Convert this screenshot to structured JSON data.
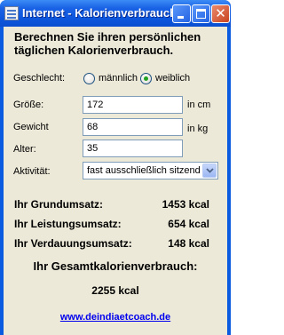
{
  "window": {
    "title": "Internet - Kalorienverbrauch..."
  },
  "heading": "Berechnen Sie ihren persönlichen täglichen Kalorienverbrauch.",
  "gender": {
    "label": "Geschlecht:",
    "options": [
      "männlich",
      "weiblich"
    ],
    "selected": "weiblich"
  },
  "height": {
    "label": "Größe:",
    "value": "172",
    "unit": "in cm"
  },
  "weight": {
    "label": "Gewicht",
    "value": "68",
    "unit": "in kg"
  },
  "age": {
    "label": "Alter:",
    "value": "35"
  },
  "activity": {
    "label": "Aktivität:",
    "selected": "fast ausschließlich sitzend"
  },
  "results": {
    "basal": {
      "label": "Ihr Grundumsatz:",
      "value": "1453 kcal"
    },
    "activity": {
      "label": "Ihr Leistungsumsatz:",
      "value": "654 kcal"
    },
    "digestion": {
      "label": "Ihr Verdauungsumsatz:",
      "value": "148 kcal"
    },
    "total": {
      "label": "Ihr Gesamtkalorienverbrauch:",
      "value": "2255 kcal"
    }
  },
  "link": "www.deindiaetcoach.de",
  "colors": {
    "titlebar": "#0c56dd",
    "client_bg": "#ece9d8",
    "link": "#0000ee",
    "radio_selected": "#21a121"
  }
}
